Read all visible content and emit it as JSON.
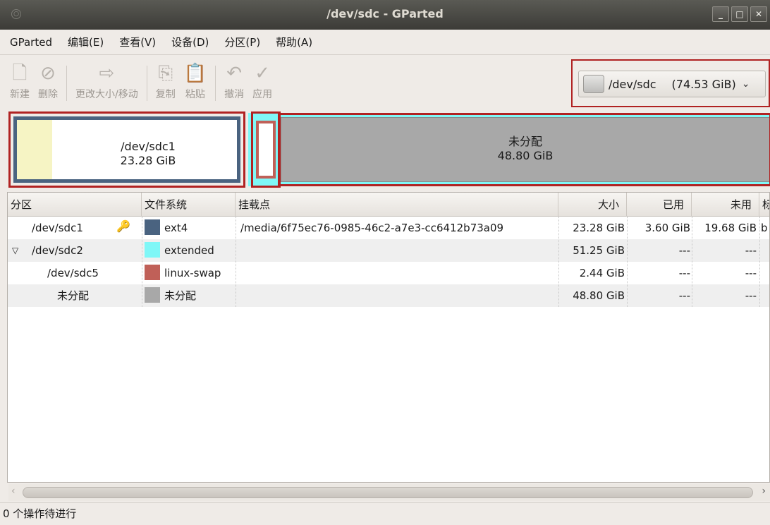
{
  "window": {
    "title": "/dev/sdc - GParted",
    "controls": [
      "_",
      "□",
      "✕"
    ]
  },
  "menu": [
    {
      "label": "GParted"
    },
    {
      "label": "编辑(E)"
    },
    {
      "label": "查看(V)"
    },
    {
      "label": "设备(D)"
    },
    {
      "label": "分区(P)"
    },
    {
      "label": "帮助(A)"
    }
  ],
  "toolbar": {
    "new": "新建",
    "delete": "删除",
    "resize": "更改大小/移动",
    "copy": "复制",
    "paste": "粘贴",
    "undo": "撤消",
    "apply": "应用"
  },
  "device_selector": {
    "device": "/dev/sdc",
    "size": "(74.53 GiB)"
  },
  "graph": {
    "p1": {
      "name": "/dev/sdc1",
      "size": "23.28 GiB"
    },
    "unallocated": {
      "name": "未分配",
      "size": "48.80 GiB"
    }
  },
  "table": {
    "headers": [
      "分区",
      "文件系统",
      "挂载点",
      "大小",
      "已用",
      "未用",
      "标"
    ],
    "rows": [
      {
        "partition": "/dev/sdc1",
        "fs": "ext4",
        "mount": "/media/6f75ec76-0985-46c2-a7e3-cc6412b73a09",
        "size": "23.28 GiB",
        "used": "3.60 GiB",
        "unused": "19.68 GiB",
        "flag": "b"
      },
      {
        "partition": "/dev/sdc2",
        "fs": "extended",
        "mount": "",
        "size": "51.25 GiB",
        "used": "---",
        "unused": "---",
        "flag": ""
      },
      {
        "partition": "/dev/sdc5",
        "fs": "linux-swap",
        "mount": "",
        "size": "2.44 GiB",
        "used": "---",
        "unused": "---",
        "flag": ""
      },
      {
        "partition": "未分配",
        "fs": "未分配",
        "mount": "",
        "size": "48.80 GiB",
        "used": "---",
        "unused": "---",
        "flag": ""
      }
    ]
  },
  "status": "0 个操作待进行",
  "colors": {
    "ext4": "#4a6380",
    "extended": "#7ff7f7",
    "linux-swap": "#c06058",
    "unallocated": "#a8a8a8",
    "highlight": "#b02222"
  }
}
